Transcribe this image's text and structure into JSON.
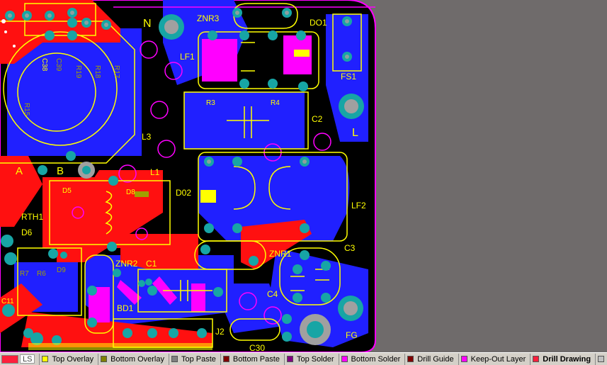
{
  "board": {
    "designators": {
      "N": "N",
      "ZNR3": "ZNR3",
      "DO1": "DO1",
      "FS1": "FS1",
      "LF1": "LF1",
      "R3": "R3",
      "R4": "R4",
      "C2": "C2",
      "L": "L",
      "L3": "L3",
      "L1": "L1",
      "D8": "D8",
      "D5": "D5",
      "D02": "D02",
      "A": "A",
      "B": "B",
      "RTH1": "RTH1",
      "D6": "D6",
      "LF2": "LF2",
      "C1": "C1",
      "ZNR2": "ZNR2",
      "ZNR1": "ZNR1",
      "C3": "C3",
      "C4": "C4",
      "BD1": "BD1",
      "J2": "J2",
      "C30": "C30",
      "FG": "FG",
      "C11": "C11",
      "R7": "R7",
      "R6": "R6",
      "D9": "D9",
      "C38": "C38",
      "R19": "R19",
      "R18": "R18",
      "R17": "R17",
      "C39": "C39",
      "R15": "R15"
    }
  },
  "layer_bar": {
    "ls_label": "LS",
    "ls_color": "#ff1f3c",
    "tabs": [
      {
        "label": "Top Overlay",
        "color": "#ffff00",
        "active": false
      },
      {
        "label": "Bottom Overlay",
        "color": "#808000",
        "active": false
      },
      {
        "label": "Top Paste",
        "color": "#808080",
        "active": false
      },
      {
        "label": "Bottom Paste",
        "color": "#800000",
        "active": false
      },
      {
        "label": "Top Solder",
        "color": "#800080",
        "active": false
      },
      {
        "label": "Bottom Solder",
        "color": "#ff00ff",
        "active": false
      },
      {
        "label": "Drill Guide",
        "color": "#800000",
        "active": false
      },
      {
        "label": "Keep-Out Layer",
        "color": "#ff00ff",
        "active": false
      },
      {
        "label": "Drill Drawing",
        "color": "#ff1f3c",
        "active": true
      },
      {
        "label": "",
        "color": "#c0c0c0",
        "active": false
      }
    ]
  }
}
